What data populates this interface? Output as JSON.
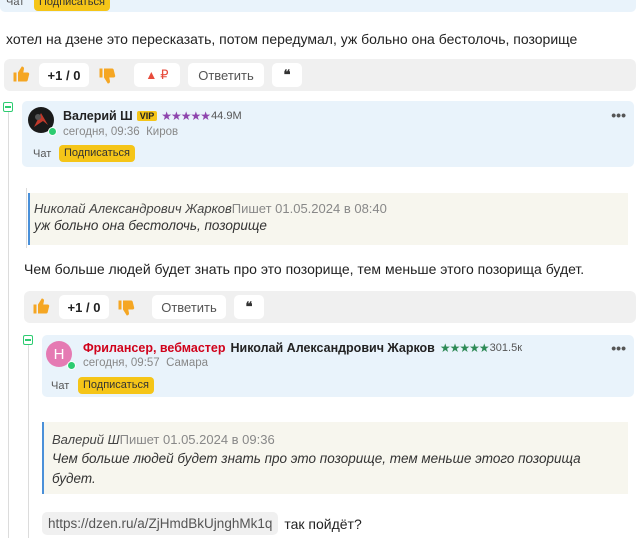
{
  "top_card": {
    "chat": "Чат",
    "subscribe": "Подписаться"
  },
  "comment1": {
    "text": "хотел на дзене это пересказать, потом передумал, уж больно она бестолочь, позорище",
    "votes": "+1 / 0",
    "rub": "₽",
    "reply": "Ответить",
    "quote_icon": "❝"
  },
  "comment2": {
    "author": "Валерий Ш",
    "vip": "VIP",
    "stars": "★★★★★",
    "rating": "44.9M",
    "meta": "сегодня, 09:36  Киров",
    "chat": "Чат",
    "subscribe": "Подписаться",
    "quote_author": "Николай Александрович Жарков",
    "quote_meta": "Пишет 01.05.2024 в 08:40",
    "quote_text": "уж больно она бестолочь, позорище",
    "text": "Чем больше людей будет знать про это позорище, тем меньше этого позорища будет.",
    "votes": "+1 / 0",
    "reply": "Ответить",
    "quote_icon": "❝"
  },
  "comment3": {
    "avatar_letter": "Н",
    "role": "Фрилансер, вебмастер",
    "author": "Николай Александрович Жарков",
    "stars": "★★★★★",
    "rating": "301.5к",
    "meta": "сегодня, 09:57  Самара",
    "chat": "Чат",
    "subscribe": "Подписаться",
    "quote_author": "Валерий Ш",
    "quote_meta": "Пишет 01.05.2024 в 09:36",
    "quote_text": "Чем больше людей будет знать про это позорище, тем меньше этого позорища будет.",
    "link": "https://dzen.ru/a/ZjHmdBkUjnghMk1q",
    "after_link": "так пойдёт?"
  },
  "colors": {
    "accent_yellow": "#f5c518",
    "card_blue": "#e9f3fb",
    "thumb_orange": "#f5a623",
    "rub_red": "#e74c3c",
    "online_green": "#2ecc71"
  }
}
